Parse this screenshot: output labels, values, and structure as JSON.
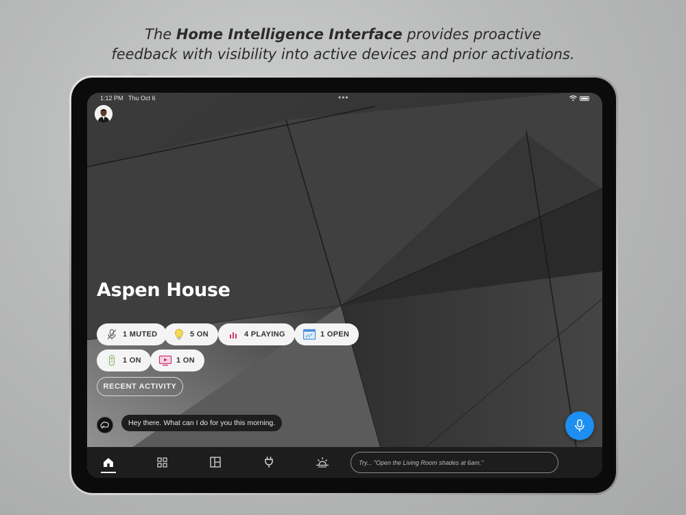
{
  "headline": {
    "prefix": "The ",
    "bold": "Home Intelligence Interface",
    "suffix": " provides proactive",
    "line2": "feedback with visibility into active devices and prior activations."
  },
  "status_bar": {
    "time": "1:12 PM",
    "date": "Thu Oct 6"
  },
  "house": {
    "title": "Aspen House"
  },
  "chips": [
    {
      "label": "1 MUTED",
      "icon": "mic-muted-icon"
    },
    {
      "label": "5 ON",
      "icon": "lightbulb-icon"
    },
    {
      "label": "4 PLAYING",
      "icon": "equalizer-icon"
    },
    {
      "label": "1 OPEN",
      "icon": "shades-icon"
    },
    {
      "label": "1 ON",
      "icon": "remote-icon"
    },
    {
      "label": "1 ON",
      "icon": "tv-icon"
    }
  ],
  "recent_activity_label": "RECENT ACTIVITY",
  "assistant_message": "Hey there. What can I do for you this morning.",
  "input": {
    "placeholder": "Try... \"Open the Living Room shades at 6am.\""
  },
  "tabs": [
    {
      "name": "home",
      "icon": "home-icon",
      "active": true
    },
    {
      "name": "rooms",
      "icon": "grid-icon",
      "active": false
    },
    {
      "name": "floorplan",
      "icon": "floorplan-icon",
      "active": false
    },
    {
      "name": "devices",
      "icon": "plug-icon",
      "active": false
    },
    {
      "name": "scenes",
      "icon": "sunrise-icon",
      "active": false
    }
  ],
  "colors": {
    "accent": "#1c8ff0",
    "chip_bg": "#f4f4f4",
    "bulb": "#e8c23a",
    "media": "#d0306f",
    "shades": "#4a90d9"
  }
}
